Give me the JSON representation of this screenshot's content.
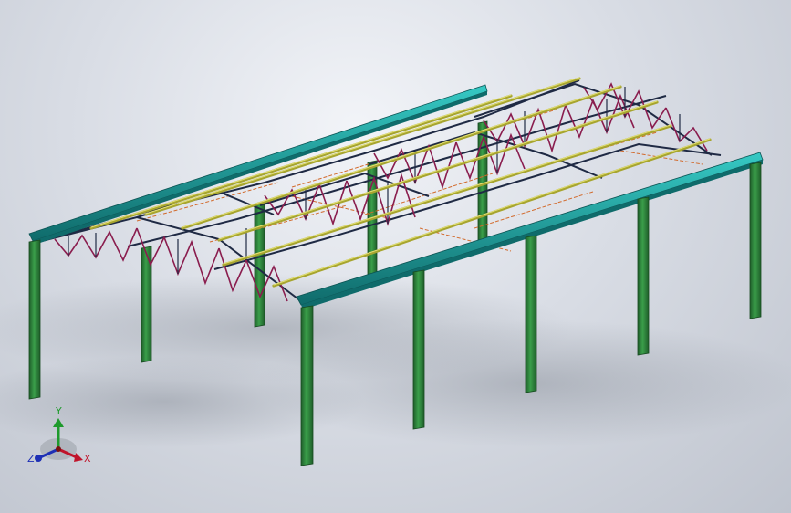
{
  "viewport": {
    "background_top": "#f1f3f7",
    "background_bottom": "#bcc1cb"
  },
  "model": {
    "colors": {
      "columns": "#2e8b3e",
      "columns_dark": "#1f5e2a",
      "eave_beam": "#1aa3a3",
      "eave_beam_dark": "#0f6b6b",
      "truss": "#1f2a44",
      "truss_web": "#8a1d4e",
      "purlin": "#b8b83a",
      "bracing": "#d26a2c"
    }
  },
  "triad": {
    "x_label": "X",
    "y_label": "Y",
    "z_label": "Z",
    "x_color": "#c0142b",
    "y_color": "#1e9a2c",
    "z_color": "#1d2fb5"
  }
}
